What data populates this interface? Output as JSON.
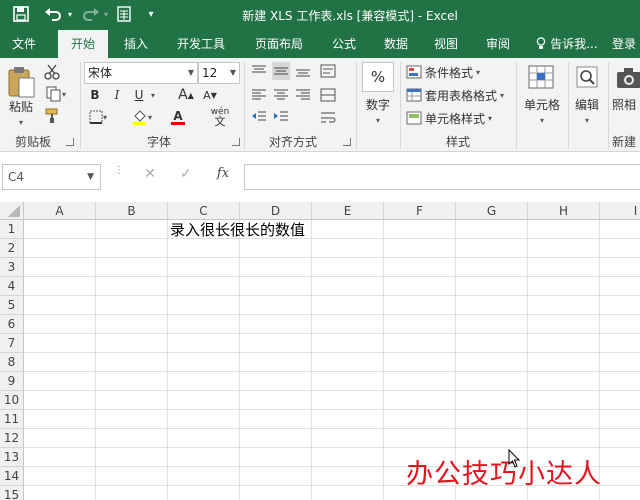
{
  "window": {
    "title": "新建 XLS 工作表.xls  [兼容模式] - Excel"
  },
  "quick_access": {
    "icons": [
      "save-icon",
      "undo-icon",
      "redo-icon",
      "form-icon",
      "customize-icon"
    ]
  },
  "tabs": [
    {
      "label": "文件",
      "active": false
    },
    {
      "label": "开始",
      "active": true
    },
    {
      "label": "插入",
      "active": false
    },
    {
      "label": "开发工具",
      "active": false
    },
    {
      "label": "页面布局",
      "active": false
    },
    {
      "label": "公式",
      "active": false
    },
    {
      "label": "数据",
      "active": false
    },
    {
      "label": "视图",
      "active": false
    },
    {
      "label": "审阅",
      "active": false
    }
  ],
  "tell_me": "告诉我...",
  "signin": "登录",
  "ribbon": {
    "clipboard": {
      "group_label": "剪贴板",
      "paste_label": "粘贴"
    },
    "font": {
      "group_label": "字体",
      "font_name": "宋体",
      "font_size": "12",
      "bold": "B",
      "italic": "I",
      "underline": "U",
      "grow": "A",
      "shrink": "A",
      "font_color_glyph": "A",
      "phonetic_glyph": "wén",
      "phonetic_char": "文"
    },
    "alignment": {
      "group_label": "对齐方式"
    },
    "number": {
      "group_label": "数字",
      "label": "数字",
      "glyph": "%"
    },
    "styles": {
      "group_label": "样式",
      "conditional": "条件格式",
      "table": "套用表格格式",
      "cell_styles": "单元格样式"
    },
    "cells": {
      "label": "单元格"
    },
    "editing": {
      "label": "编辑"
    },
    "extra": {
      "label1": "照相",
      "label2": "新建"
    }
  },
  "formula_bar": {
    "name_box": "C4",
    "cancel": "✕",
    "enter": "✓",
    "fx": "fx",
    "value": ""
  },
  "sheet": {
    "columns": [
      "A",
      "B",
      "C",
      "D",
      "E",
      "F",
      "G",
      "H",
      "I"
    ],
    "rows": [
      "1",
      "2",
      "3",
      "4",
      "5",
      "6",
      "7",
      "8",
      "9",
      "10",
      "11",
      "12",
      "13",
      "14",
      "15"
    ],
    "cell_c1": "录入很长很长的数值"
  },
  "watermark": "办公技巧小达人",
  "colors": {
    "brand": "#217346",
    "watermark": "#e6141e"
  }
}
